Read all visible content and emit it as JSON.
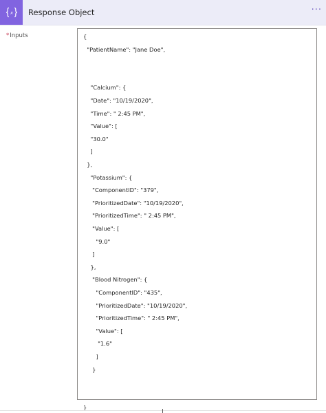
{
  "action": {
    "icon": "curly-braces-expression-icon",
    "title": "Response Object",
    "more_label": "···",
    "accent_color": "#8164e0",
    "header_bg": "#ececf8"
  },
  "field": {
    "required_marker": "*",
    "label": "Inputs"
  },
  "code_lines": [
    "{",
    "  \"PatientName\": \"Jane Doe\",",
    "",
    "",
    "    \"Calcium\": {",
    "    \"Date\": \"10/19/2020\",",
    "    \"Time\": \" 2:45 PM\",",
    "    \"Value\": [",
    "    \"30.0\"",
    "    ]",
    "  },",
    "    \"Potassium\": {",
    "     \"ComponentID\": \"379\",",
    "     \"PrioritizedDate\": \"10/19/2020\",",
    "     \"PrioritizedTime\": \" 2:45 PM\",",
    "     \"Value\": [",
    "       \"9.0\"",
    "     ]",
    "    },",
    "     \"Blood Nitrogen\": {",
    "       \"ComponentID\": \"435\",",
    "       \"PrioritizedDate\": \"10/19/2020\",",
    "       \"PrioritizedTime\": \" 2:45 PM\",",
    "       \"Value\": [",
    "        \"1.6\"",
    "       ]",
    "     }",
    "",
    "",
    "}"
  ]
}
